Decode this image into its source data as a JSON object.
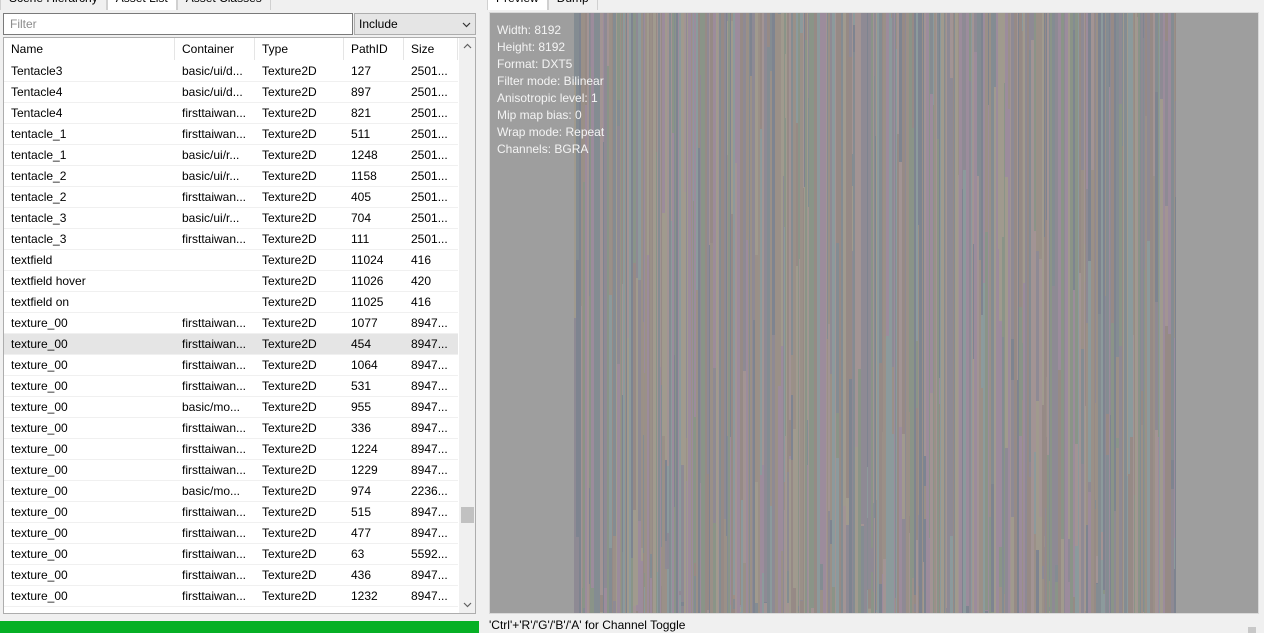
{
  "left_tabs": [
    "Scene Hierarchy",
    "Asset List",
    "Asset Classes"
  ],
  "filter": {
    "placeholder": "Filter",
    "value": ""
  },
  "include_select": {
    "selected": "Include"
  },
  "columns": [
    "Name",
    "Container",
    "Type",
    "PathID",
    "Size"
  ],
  "rows": [
    {
      "name": "Tentacle3",
      "container": "basic/ui/d...",
      "type": "Texture2D",
      "path_id": "127",
      "size": "2501..."
    },
    {
      "name": "Tentacle4",
      "container": "basic/ui/d...",
      "type": "Texture2D",
      "path_id": "897",
      "size": "2501..."
    },
    {
      "name": "Tentacle4",
      "container": "firsttaiwan...",
      "type": "Texture2D",
      "path_id": "821",
      "size": "2501..."
    },
    {
      "name": "tentacle_1",
      "container": "firsttaiwan...",
      "type": "Texture2D",
      "path_id": "511",
      "size": "2501..."
    },
    {
      "name": "tentacle_1",
      "container": "basic/ui/r...",
      "type": "Texture2D",
      "path_id": "1248",
      "size": "2501..."
    },
    {
      "name": "tentacle_2",
      "container": "basic/ui/r...",
      "type": "Texture2D",
      "path_id": "1158",
      "size": "2501..."
    },
    {
      "name": "tentacle_2",
      "container": "firsttaiwan...",
      "type": "Texture2D",
      "path_id": "405",
      "size": "2501..."
    },
    {
      "name": "tentacle_3",
      "container": "basic/ui/r...",
      "type": "Texture2D",
      "path_id": "704",
      "size": "2501..."
    },
    {
      "name": "tentacle_3",
      "container": "firsttaiwan...",
      "type": "Texture2D",
      "path_id": "111",
      "size": "2501..."
    },
    {
      "name": "textfield",
      "container": "",
      "type": "Texture2D",
      "path_id": "11024",
      "size": "416"
    },
    {
      "name": "textfield hover",
      "container": "",
      "type": "Texture2D",
      "path_id": "11026",
      "size": "420"
    },
    {
      "name": "textfield on",
      "container": "",
      "type": "Texture2D",
      "path_id": "11025",
      "size": "416"
    },
    {
      "name": "texture_00",
      "container": "firsttaiwan...",
      "type": "Texture2D",
      "path_id": "1077",
      "size": "8947..."
    },
    {
      "name": "texture_00",
      "container": "firsttaiwan...",
      "type": "Texture2D",
      "path_id": "454",
      "size": "8947...",
      "selected": true
    },
    {
      "name": "texture_00",
      "container": "firsttaiwan...",
      "type": "Texture2D",
      "path_id": "1064",
      "size": "8947..."
    },
    {
      "name": "texture_00",
      "container": "firsttaiwan...",
      "type": "Texture2D",
      "path_id": "531",
      "size": "8947..."
    },
    {
      "name": "texture_00",
      "container": "basic/mo...",
      "type": "Texture2D",
      "path_id": "955",
      "size": "8947..."
    },
    {
      "name": "texture_00",
      "container": "firsttaiwan...",
      "type": "Texture2D",
      "path_id": "336",
      "size": "8947..."
    },
    {
      "name": "texture_00",
      "container": "firsttaiwan...",
      "type": "Texture2D",
      "path_id": "1224",
      "size": "8947..."
    },
    {
      "name": "texture_00",
      "container": "firsttaiwan...",
      "type": "Texture2D",
      "path_id": "1229",
      "size": "8947..."
    },
    {
      "name": "texture_00",
      "container": "basic/mo...",
      "type": "Texture2D",
      "path_id": "974",
      "size": "2236..."
    },
    {
      "name": "texture_00",
      "container": "firsttaiwan...",
      "type": "Texture2D",
      "path_id": "515",
      "size": "8947..."
    },
    {
      "name": "texture_00",
      "container": "firsttaiwan...",
      "type": "Texture2D",
      "path_id": "477",
      "size": "8947..."
    },
    {
      "name": "texture_00",
      "container": "firsttaiwan...",
      "type": "Texture2D",
      "path_id": "63",
      "size": "5592..."
    },
    {
      "name": "texture_00",
      "container": "firsttaiwan...",
      "type": "Texture2D",
      "path_id": "436",
      "size": "8947..."
    },
    {
      "name": "texture_00",
      "container": "firsttaiwan...",
      "type": "Texture2D",
      "path_id": "1232",
      "size": "8947..."
    }
  ],
  "scrollbar": {
    "position_fraction": 0.86
  },
  "progress": {
    "fraction": 1.0,
    "color": "#06b025"
  },
  "right_tabs": [
    "Preview",
    "Dump"
  ],
  "texture_info": [
    "Width: 8192",
    "Height: 8192",
    "Format: DXT5",
    "Filter mode: Bilinear",
    "Anisotropic level: 1",
    "Mip map bias: 0",
    "Wrap mode: Repeat",
    "Channels: BGRA"
  ],
  "hint": "'Ctrl'+'R'/'G'/'B'/'A' for Channel Toggle",
  "colors": {
    "preview_bg": "#9e9e9e",
    "selection": "#e5e5e5"
  }
}
